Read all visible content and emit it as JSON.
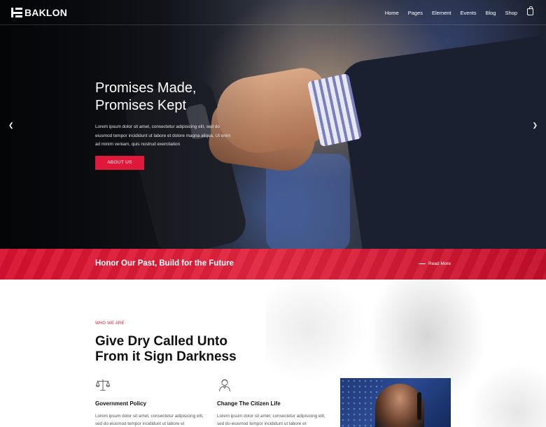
{
  "brand": {
    "logo_text": "BAKLON"
  },
  "nav": {
    "items": [
      "Home",
      "Pages",
      "Element",
      "Events",
      "Blog",
      "Shop"
    ],
    "cart_icon": "shopping-bag-icon"
  },
  "hero": {
    "title_line1": "Promises Made,",
    "title_line2": "Promises Kept",
    "body": "Lorem ipsum dolor sit amet, consectetur adipisicing elit, sed do eiusmod tempor incididunt ut labore et dolore magna aliqua. Ut enim ad minim veniam, quis nostrud exercitation",
    "button_label": "ABOUT US",
    "prev_icon": "chevron-left-icon",
    "next_icon": "chevron-right-icon",
    "prev_glyph": "❮",
    "next_glyph": "❯"
  },
  "band": {
    "title": "Honor Our Past, Build for the Future",
    "link_label": "Read More"
  },
  "about": {
    "eyebrow": "WHO WE ARE",
    "title_line1": "Give Dry Called Unto",
    "title_line2": "From it Sign Darkness",
    "features": [
      {
        "icon": "scales-icon",
        "title": "Government Policy",
        "body": "Lorem ipsum dolor sit amet, consectetur adipisicing elit, sed do eiusmod tempor incididunt ut labore et"
      },
      {
        "icon": "citizen-icon",
        "title": "Change The Citizen Life",
        "body": "Lorem ipsum dolor sit amet, consectetur adipisicing elit, sed do eiusmod tempor incididunt ut labore et"
      }
    ]
  },
  "colors": {
    "accent": "#e0193a",
    "band_red": "#d8112f",
    "text_dark": "#111111"
  }
}
